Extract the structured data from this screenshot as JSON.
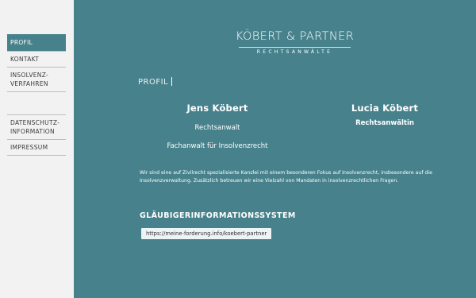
{
  "sidebar": {
    "group1": [
      {
        "lines": [
          "PROFIL"
        ],
        "active": true
      },
      {
        "lines": [
          "KONTAKT"
        ]
      },
      {
        "lines": [
          "INSOLVENZ-",
          "VERFAHREN"
        ]
      }
    ],
    "group2": [
      {
        "lines": [
          "DATENSCHUTZ-",
          "INFORMATION"
        ]
      },
      {
        "lines": [
          "IMPRESSUM"
        ]
      }
    ]
  },
  "logo": {
    "name": "KÖBERT & PARTNER",
    "subtitle": "RECHTSANWÄLTE"
  },
  "section_title": "PROFIL",
  "persons": [
    {
      "name": "Jens Köbert",
      "title1": "Rechtsanwalt",
      "title2": "Fachanwalt für Insolvenzrecht"
    },
    {
      "name": "Lucia Köbert",
      "title1": "Rechtsanwältin",
      "title2": ""
    }
  ],
  "description": "Wir sind eine auf Zivilrecht spezialisierte Kanzlei mit einem besonderen Fokus auf Insolvenzrecht, insbesondere auf die Insolvenzverwaltung. Zusätzlich betreuen wir eine Vielzahl von Mandaten in insolvenzrechtlichen Fragen.",
  "creditor_section": {
    "heading": "GLÄUBIGERINFORMATIONSSYSTEM",
    "link": "https://meine-forderung.info/koebert-partner"
  },
  "colors": {
    "teal": "#47828c",
    "sidebar_bg": "#f2f2f2"
  }
}
